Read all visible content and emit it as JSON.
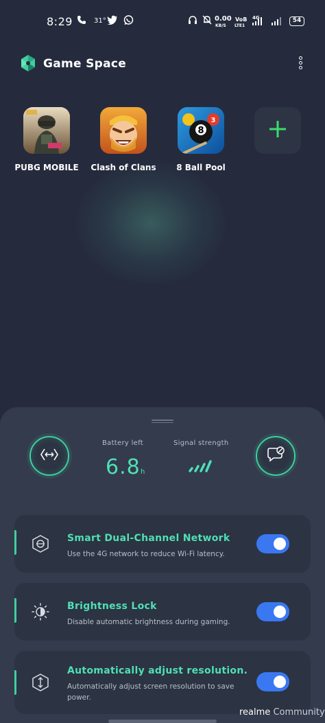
{
  "status_bar": {
    "time": "8:29",
    "temperature": "31°",
    "network_speed": "0.00",
    "network_unit": "KB/S",
    "volte": "VoB",
    "lte": "LTE1",
    "network_type": "4G",
    "battery": "54",
    "icons": [
      "phone-icon",
      "twitter-icon",
      "whatsapp-icon",
      "headset-icon",
      "mute-bell-icon",
      "signal-icon"
    ]
  },
  "header": {
    "title": "Game Space",
    "more_icon": "more-vertical-icon"
  },
  "games": [
    {
      "name": "PUBG MOBILE",
      "color": "#c9a16a"
    },
    {
      "name": "Clash of Clans",
      "color": "#d98a2b"
    },
    {
      "name": "8 Ball Pool",
      "color": "#2b8fd9"
    }
  ],
  "add_game": {
    "icon": "plus-icon",
    "color": "#3ddc6e"
  },
  "stats": {
    "battery_label": "Battery left",
    "battery_value": "6.8",
    "battery_unit": "h",
    "signal_label": "Signal strength",
    "accent": "#4fe0b5"
  },
  "settings": [
    {
      "title": "Smart Dual-Channel Network",
      "description": "Use the 4G network to reduce Wi-Fi latency.",
      "icon": "network-hexagon-icon",
      "enabled": true
    },
    {
      "title": "Brightness Lock",
      "description": "Disable automatic brightness during gaming.",
      "icon": "brightness-icon",
      "enabled": true
    },
    {
      "title": "Automatically adjust resolution.",
      "description": "Automatically adjust screen resolution to save power.",
      "icon": "resolution-icon",
      "enabled": true
    }
  ],
  "watermark": {
    "brand": "realme",
    "suffix": "Community"
  },
  "colors": {
    "background": "#252b3d",
    "panel": "#333b4d",
    "toggle_on": "#3a78f2"
  }
}
